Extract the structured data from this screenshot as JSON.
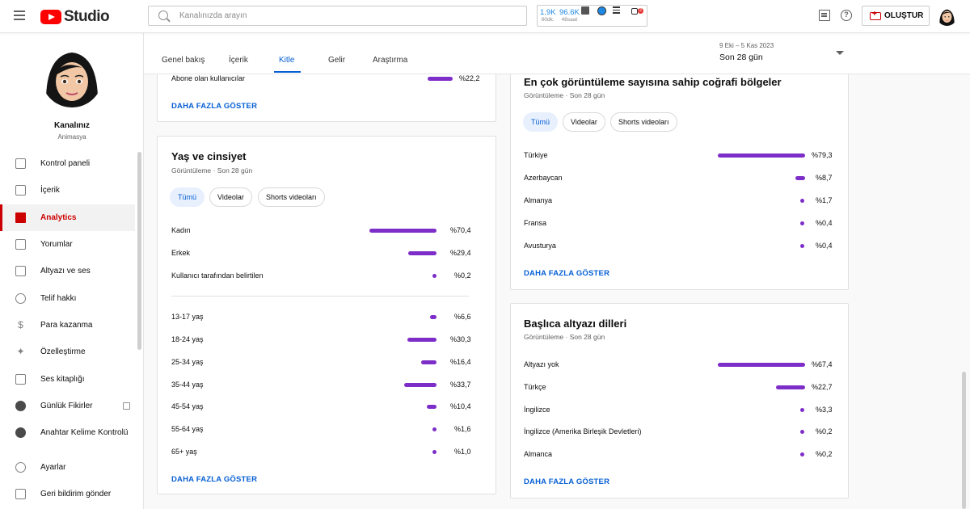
{
  "header": {
    "app_name": "Studio",
    "search_placeholder": "Kanalınızda arayın",
    "stat1_value": "1.9K",
    "stat1_label": "60dk.",
    "stat2_value": "96.6K",
    "stat2_label": "48saat",
    "notif_count": "2",
    "help_glyph": "?",
    "create_label": "OLUŞTUR"
  },
  "sidebar": {
    "channel_name": "Kanalınız",
    "channel_sub": "Animasya",
    "items": [
      {
        "label": "Kontrol paneli",
        "icon": "dashboard-icon"
      },
      {
        "label": "İçerik",
        "icon": "content-icon"
      },
      {
        "label": "Analytics",
        "icon": "analytics-icon"
      },
      {
        "label": "Yorumlar",
        "icon": "comments-icon"
      },
      {
        "label": "Altyazı ve ses",
        "icon": "subtitles-icon"
      },
      {
        "label": "Telif hakkı",
        "icon": "copyright-icon"
      },
      {
        "label": "Para kazanma",
        "icon": "dollar-icon"
      },
      {
        "label": "Özelleştirme",
        "icon": "magic-wand-icon"
      },
      {
        "label": "Ses kitaplığı",
        "icon": "audio-library-icon"
      },
      {
        "label": "Günlük Fikirler",
        "icon": "tubebuddy-icon"
      },
      {
        "label": "Anahtar Kelime Kontrolü",
        "icon": "tubebuddy-icon"
      },
      {
        "label": "Ayarlar",
        "icon": "gear-icon"
      },
      {
        "label": "Geri bildirim gönder",
        "icon": "feedback-icon"
      }
    ]
  },
  "tabs": [
    "Genel bakış",
    "İçerik",
    "Kitle",
    "Gelir",
    "Araştırma"
  ],
  "date_range": {
    "dates": "9 Eki – 5 Kas 2023",
    "label": "Son 28 gün"
  },
  "subscriber_card": {
    "row_label": "Abone olan kullanıcılar",
    "row_value": "%22,2",
    "more": "DAHA FAZLA GÖSTER"
  },
  "age_gender_card": {
    "title": "Yaş ve cinsiyet",
    "subtitle": "Görüntüleme · Son 28 gün",
    "chips": [
      "Tümü",
      "Videolar",
      "Shorts videoları"
    ],
    "gender_rows": [
      {
        "label": "Kadın",
        "value": "%70,4",
        "pct": 70.4
      },
      {
        "label": "Erkek",
        "value": "%29,4",
        "pct": 29.4
      },
      {
        "label": "Kullanıcı tarafından belirtilen",
        "value": "%0,2",
        "pct": 0.2
      }
    ],
    "age_rows": [
      {
        "label": "13-17 yaş",
        "value": "%6,6",
        "pct": 6.6
      },
      {
        "label": "18-24 yaş",
        "value": "%30,3",
        "pct": 30.3
      },
      {
        "label": "25-34 yaş",
        "value": "%16,4",
        "pct": 16.4
      },
      {
        "label": "35-44 yaş",
        "value": "%33,7",
        "pct": 33.7
      },
      {
        "label": "45-54 yaş",
        "value": "%10,4",
        "pct": 10.4
      },
      {
        "label": "55-64 yaş",
        "value": "%1,6",
        "pct": 1.6
      },
      {
        "label": "65+ yaş",
        "value": "%1,0",
        "pct": 1.0
      }
    ],
    "more": "DAHA FAZLA GÖSTER"
  },
  "geo_card": {
    "title": "En çok görüntüleme sayısına sahip coğrafi bölgeler",
    "subtitle": "Görüntüleme · Son 28 gün",
    "chips": [
      "Tümü",
      "Videolar",
      "Shorts videoları"
    ],
    "rows": [
      {
        "label": "Türkiye",
        "value": "%79,3",
        "pct": 79.3
      },
      {
        "label": "Azerbaycan",
        "value": "%8,7",
        "pct": 8.7
      },
      {
        "label": "Almanya",
        "value": "%1,7",
        "pct": 1.7
      },
      {
        "label": "Fransa",
        "value": "%0,4",
        "pct": 0.4
      },
      {
        "label": "Avusturya",
        "value": "%0,4",
        "pct": 0.4
      }
    ],
    "more": "DAHA FAZLA GÖSTER"
  },
  "subtitle_card": {
    "title": "Başlıca altyazı dilleri",
    "subtitle": "Görüntüleme · Son 28 gün",
    "rows": [
      {
        "label": "Altyazı yok",
        "value": "%67,4",
        "pct": 67.4
      },
      {
        "label": "Türkçe",
        "value": "%22,7",
        "pct": 22.7
      },
      {
        "label": "İngilizce",
        "value": "%3,3",
        "pct": 3.3
      },
      {
        "label": "İngilizce (Amerika Birleşik Devletleri)",
        "value": "%0,2",
        "pct": 0.2
      },
      {
        "label": "Almanca",
        "value": "%0,2",
        "pct": 0.2
      }
    ],
    "more": "DAHA FAZLA GÖSTER"
  },
  "colors": {
    "accent": "#cc0000",
    "bar": "#7e2ec8",
    "link": "#065fd4"
  }
}
